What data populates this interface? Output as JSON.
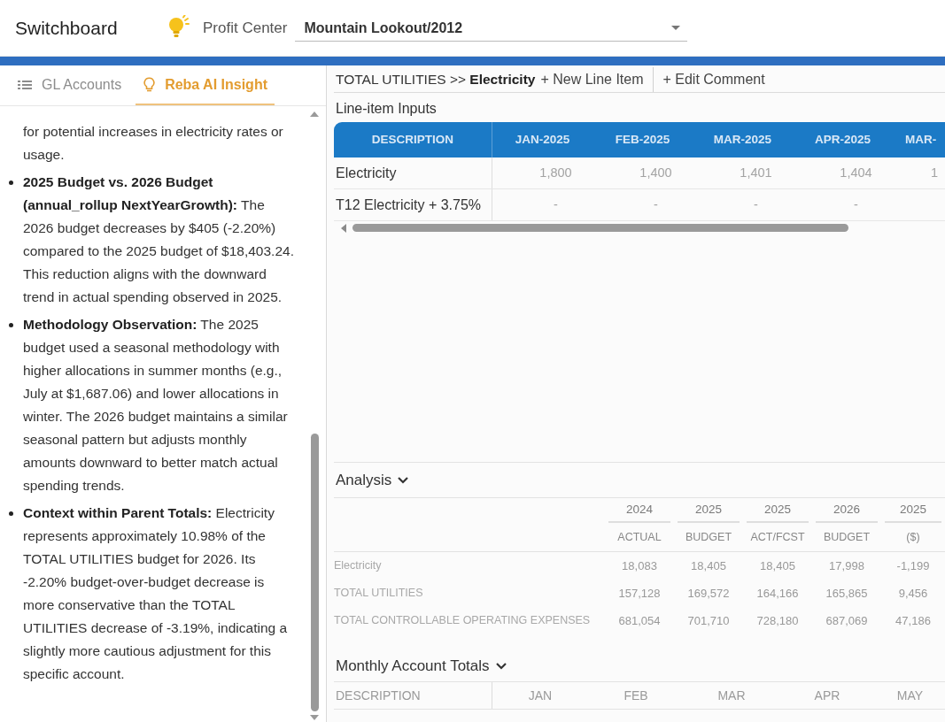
{
  "header": {
    "app_title": "Switchboard",
    "profit_center_label": "Profit Center",
    "profit_center": "Mountain Lookout/2012"
  },
  "left_panel": {
    "tabs": [
      {
        "label": "GL Accounts",
        "selected": false
      },
      {
        "label": "Reba AI Insight",
        "selected": true
      }
    ],
    "insight": {
      "continuation": "for potential increases in electricity rates or usage.",
      "bullets": [
        "**2025 Budget vs. 2026 Budget (annual_rollup NextYearGrowth):** The 2026 budget decreases by $405 (-2.20%) compared to the 2025 budget of $18,403.24. This reduction aligns with the downward trend in actual spending observed in 2025.",
        "**Methodology Observation:** The 2025 budget used a seasonal methodology with higher allocations in summer months (e.g., July at $1,687.06) and lower allocations in winter. The 2026 budget maintains a similar seasonal pattern but adjusts monthly amounts downward to better match actual spending trends.",
        "**Context within Parent Totals:** Electricity represents approximately 10.98% of the TOTAL UTILITIES budget for 2026. Its -2.20% budget-over-budget decrease is more conservative than the TOTAL UTILITIES decrease of -3.19%, indicating a slightly more cautious adjustment for this specific account."
      ]
    }
  },
  "detail": {
    "breadcrumb": "TOTAL UTILITIES >> **Electricity**",
    "actions": [
      "+ New Line Item",
      "+ Edit Comment"
    ],
    "line_item_inputs": {
      "title": "Line-item Inputs",
      "columns": [
        "DESCRIPTION",
        "JAN-2025",
        "FEB-2025",
        "MAR-2025",
        "APR-2025",
        "MAR-"
      ],
      "rows": [
        [
          "Electricity",
          "1,800",
          "1,400",
          "1,401",
          "1,404",
          "1"
        ],
        [
          "T12 Electricity + 3.75%",
          "-",
          "-",
          "-",
          "-"
        ]
      ]
    },
    "analysis": {
      "title": "Analysis",
      "expanded": true,
      "column_groups": [
        "2024",
        "2025",
        "2025",
        "2026",
        "2025"
      ],
      "columns": [
        "ACTUAL",
        "BUDGET",
        "ACT/FCST",
        "BUDGET",
        "($)"
      ],
      "rows": [
        {
          "label": "Electricity",
          "values": [
            "18,083",
            "18,405",
            "18,405",
            "17,998",
            "-1,199"
          ]
        },
        {
          "label": "TOTAL UTILITIES",
          "values": [
            "157,128",
            "169,572",
            "164,166",
            "165,865",
            "9,456"
          ]
        },
        {
          "label": "TOTAL CONTROLLABLE OPERATING EXPENSES",
          "values": [
            "681,054",
            "701,710",
            "728,180",
            "687,069",
            "47,186"
          ]
        }
      ]
    },
    "monthly_account_totals": {
      "title": "Monthly Account Totals",
      "expanded": true,
      "columns": [
        "DESCRIPTION",
        "JAN",
        "FEB",
        "MAR",
        "APR",
        "MAY"
      ]
    }
  }
}
